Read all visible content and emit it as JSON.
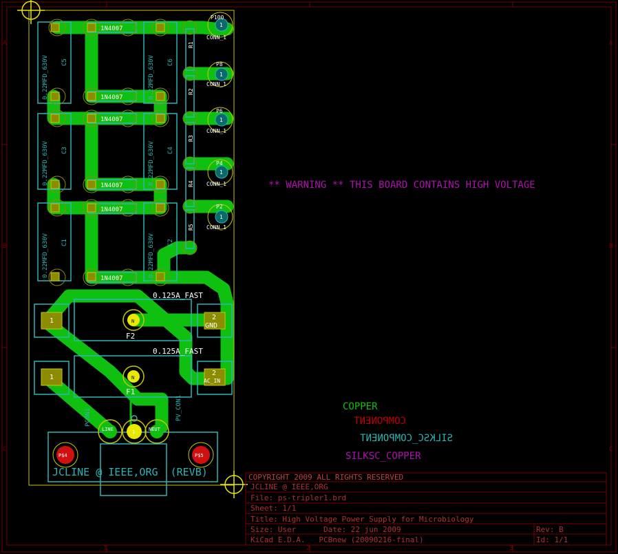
{
  "colors": {
    "background": "#000000",
    "copper": "#10c010",
    "component": "#c00000",
    "silk_component": "#2ab5b5",
    "silk_copper": "#b010b0",
    "pad": "#8c8c00",
    "edge": "#c8c800",
    "frame": "#7a0000",
    "frame_text": "#b03030"
  },
  "frame": {
    "col_labels": [
      "1",
      "2",
      "3"
    ],
    "row_labels": [
      "A",
      "B",
      "C"
    ]
  },
  "board": {
    "caps": [
      {
        "ref": "C5",
        "value": "0.22MFD_630V"
      },
      {
        "ref": "C6",
        "value": "0.22MFD_630V"
      },
      {
        "ref": "C3",
        "value": "0.22MFD_630V"
      },
      {
        "ref": "C4",
        "value": "0.22MFD_630V"
      },
      {
        "ref": "C1",
        "value": "0.22MFD_630V"
      },
      {
        "ref": "C2",
        "value": "0.22MFD_630V"
      }
    ],
    "diode_label": "1N4007",
    "resistors": [
      "R1",
      "R2",
      "R3",
      "R4",
      "R5"
    ],
    "connectors": [
      {
        "ref": "P100",
        "pin": "1",
        "value": "CONN_1"
      },
      {
        "ref": "P8",
        "pin": "1",
        "value": "CONN_1"
      },
      {
        "ref": "P6",
        "pin": "1",
        "value": "CONN_1"
      },
      {
        "ref": "P4",
        "pin": "1",
        "value": "CONN_1"
      },
      {
        "ref": "P2",
        "pin": "1",
        "value": "CONN_1"
      }
    ],
    "fuses": [
      {
        "ref": "F2",
        "value": "0.125A_FAST",
        "pin1": "1",
        "pin2": "2",
        "pin2_label": "GND",
        "mid": "N"
      },
      {
        "ref": "F1",
        "value": "0.125A_FAST",
        "pin1": "1",
        "pin2": "2",
        "pin2_label": "AC_IN",
        "mid": "N"
      }
    ],
    "power_conn": {
      "ref": "PCON1",
      "value": "PV_CON1",
      "pins": [
        "LINE",
        "1",
        "NEUT"
      ],
      "mount_holes": [
        "P$4",
        "P$5"
      ]
    },
    "board_text": "JCLINE @ IEEE,ORG  (REVB)",
    "warning": "** WARNING ** THIS BOARD CONTAINS HIGH VOLTAGE"
  },
  "layers": {
    "copper": "COPPER",
    "component": "COMPONENT",
    "silk_component": "SILKSC_COMPONENT",
    "silk_copper": "SILKSC_COPPER"
  },
  "title_block": {
    "copyright": "COPYRIGHT 2009 ALL RIGHTS RESERVED",
    "author": "JCLINE @ IEEE,ORG",
    "file": "File: ps-tripler1.brd",
    "sheet": "Sheet: 1/1",
    "title": "Title: High Voltage Power Supply for Microbiology",
    "size": "Size: User",
    "date": "Date: 22 jun 2009",
    "rev": "Rev: B",
    "tool": "KiCad E.D.A.   PCBnew (20090216-final)",
    "id": "Id: 1/1"
  }
}
